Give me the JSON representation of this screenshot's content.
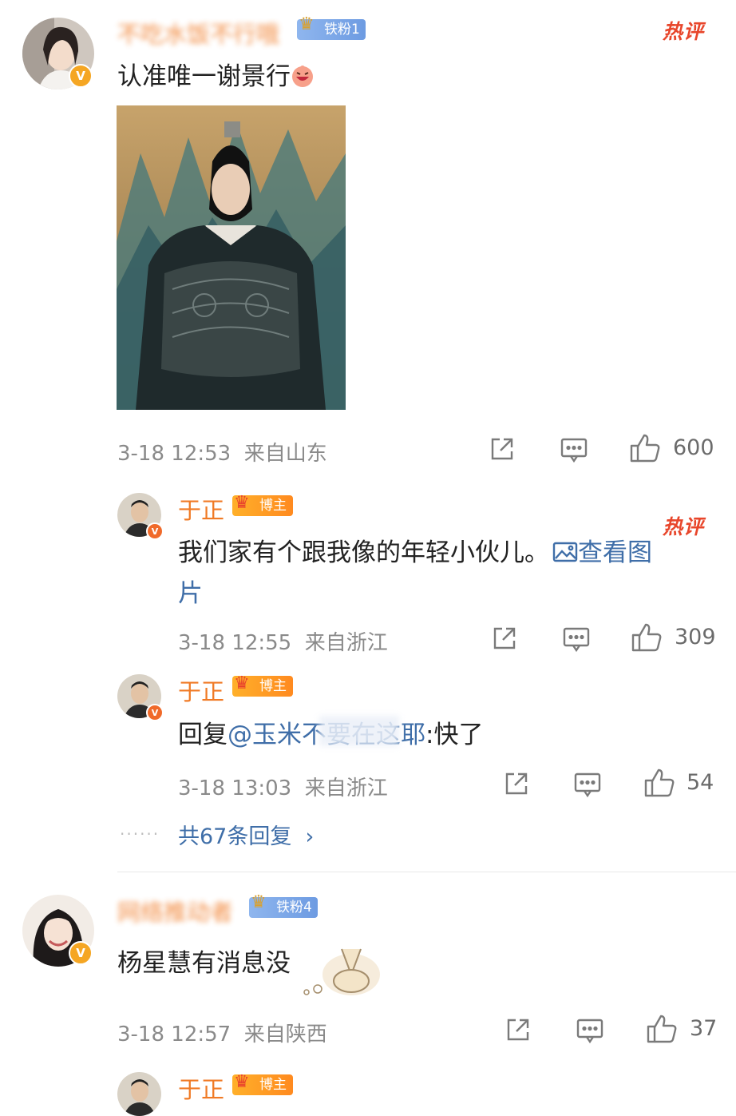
{
  "colors": {
    "accent_orange": "#f07a25",
    "link_blue": "#3f6ea8",
    "hot_red": "#e8462b",
    "meta_gray": "#8a8a8a"
  },
  "comments": [
    {
      "user": "不吃水饭不行哦",
      "fan_badge": "铁粉1",
      "hot_label": "热评",
      "text": "认准唯一谢景行",
      "emoji": "laughing-emoji",
      "time": "3-18 12:53",
      "location": "来自山东",
      "likes": "600",
      "replies": [
        {
          "user": "于正",
          "badge": "博主",
          "hot_label": "热评",
          "text_line1": "我们家有个跟我像的年轻小伙儿。",
          "link_text": "查看图",
          "text_line2": "片",
          "time": "3-18 12:55",
          "location": "来自浙江",
          "likes": "309"
        },
        {
          "user": "于正",
          "badge": "博主",
          "reply_prefix": "回复",
          "mention": "@玉米不要在这耶",
          "reply_text": ":快了",
          "time": "3-18 13:03",
          "location": "来自浙江",
          "likes": "54"
        }
      ],
      "more_replies": "共67条回复",
      "more_chevron": "›"
    },
    {
      "user": "网络推动者",
      "fan_badge": "铁粉4",
      "text": "杨星慧有消息没",
      "time": "3-18 12:57",
      "location": "来自陕西",
      "likes": "37",
      "replies": [
        {
          "user": "于正",
          "badge": "博主"
        }
      ]
    }
  ],
  "icons": {
    "verified": "V",
    "share": "share-icon",
    "comment": "comment-icon",
    "like": "thumbs-up-icon",
    "image_link": "image-icon"
  }
}
